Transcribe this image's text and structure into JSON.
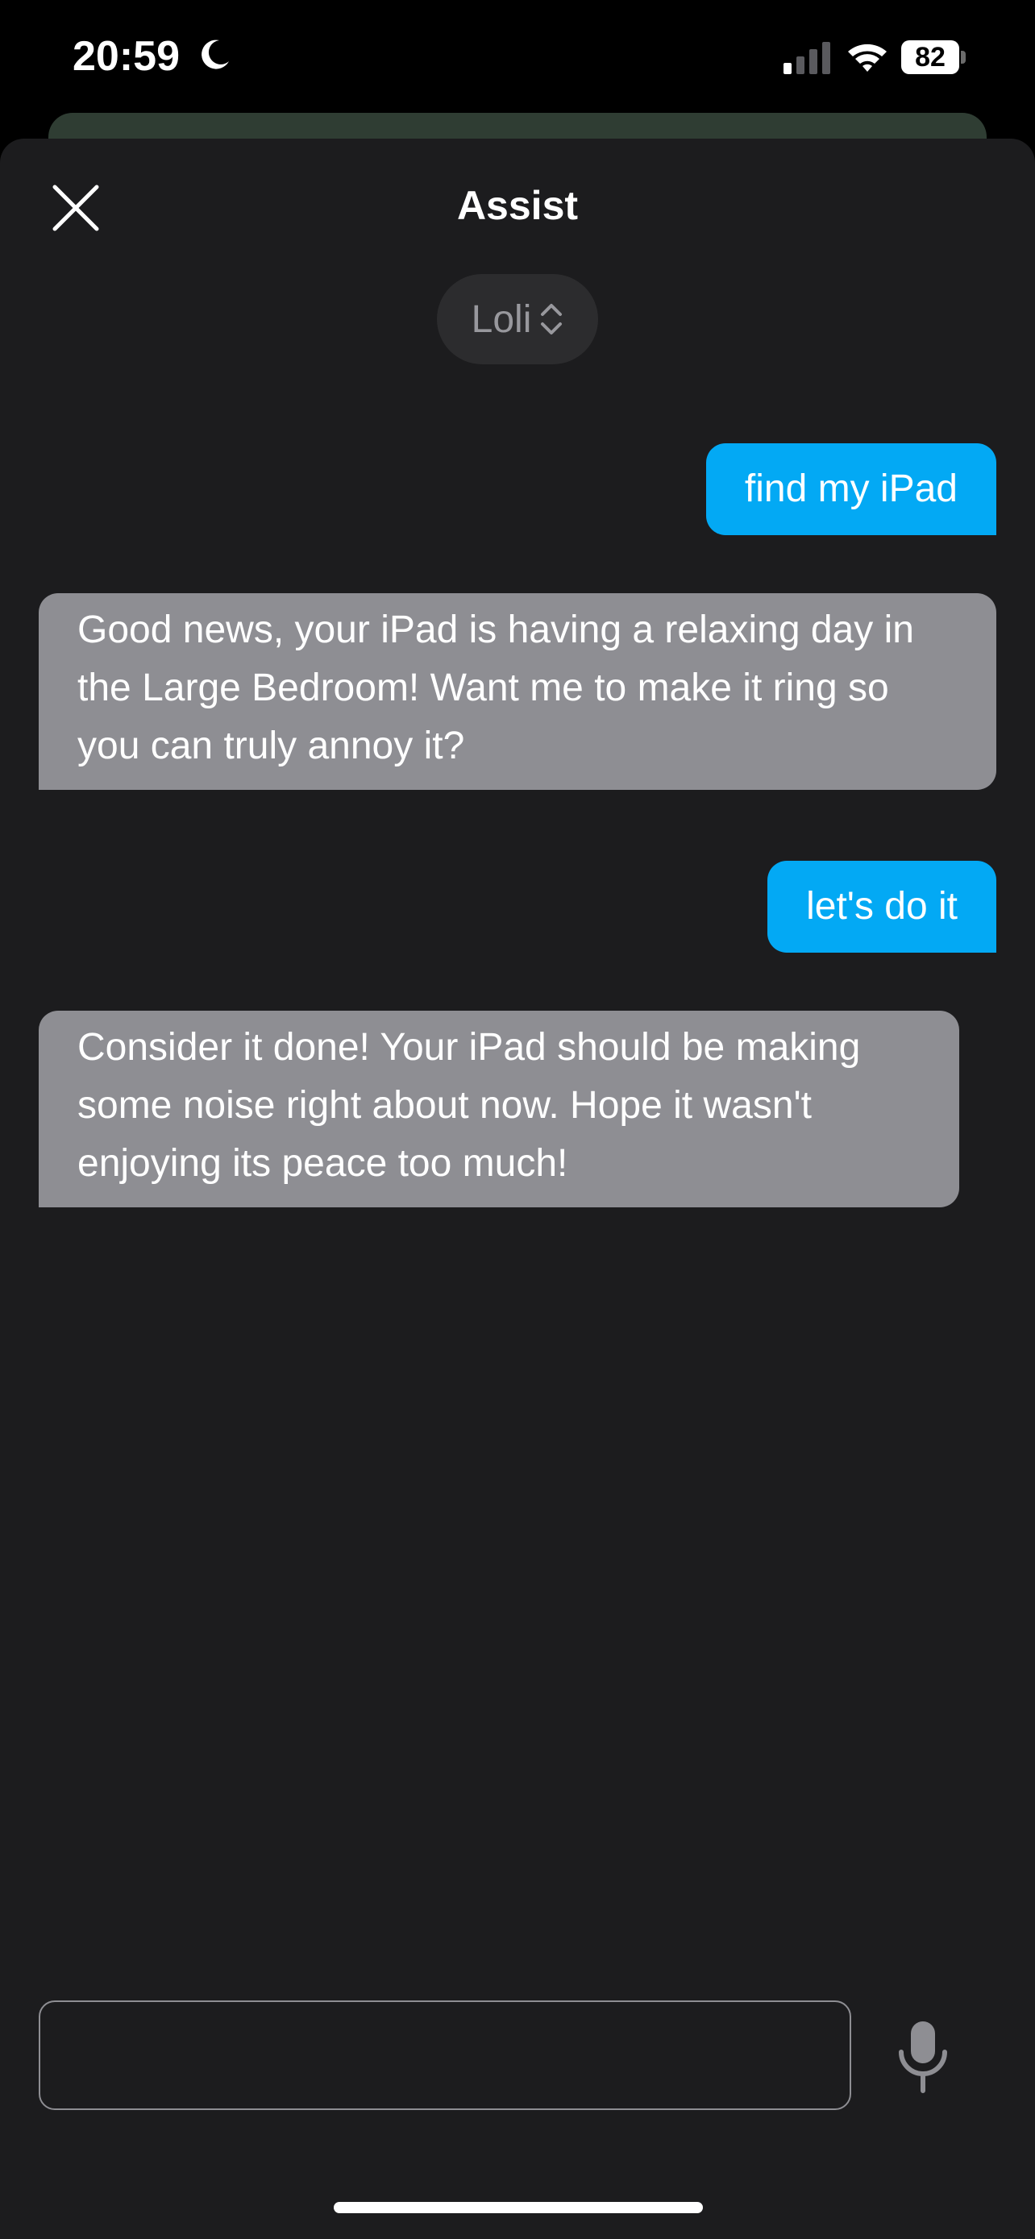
{
  "status_bar": {
    "time": "20:59",
    "battery_level": "82",
    "icons": [
      "moon-icon",
      "signal-icon",
      "wifi-icon",
      "battery-icon"
    ]
  },
  "header": {
    "title": "Assist",
    "close_icon": "close-icon"
  },
  "pipeline": {
    "selected": "Loli",
    "icon": "chevron-updown-icon"
  },
  "conversation": {
    "messages": [
      {
        "role": "user",
        "text": "find my iPad"
      },
      {
        "role": "assistant",
        "text": "Good news, your iPad is having a relaxing day in the Large Bedroom! Want me to make it ring so you can truly annoy it?"
      },
      {
        "role": "user",
        "text": "let's do it"
      },
      {
        "role": "assistant",
        "text": "Consider it done! Your iPad should be making some noise right about now. Hope it wasn't enjoying its peace too much!"
      }
    ]
  },
  "composer": {
    "value": "",
    "placeholder": "",
    "mic_icon": "microphone-icon"
  },
  "colors": {
    "user_bubble": "#03a9f4",
    "assistant_bubble": "#8e8e93",
    "sheet_background": "#1c1c1e"
  }
}
